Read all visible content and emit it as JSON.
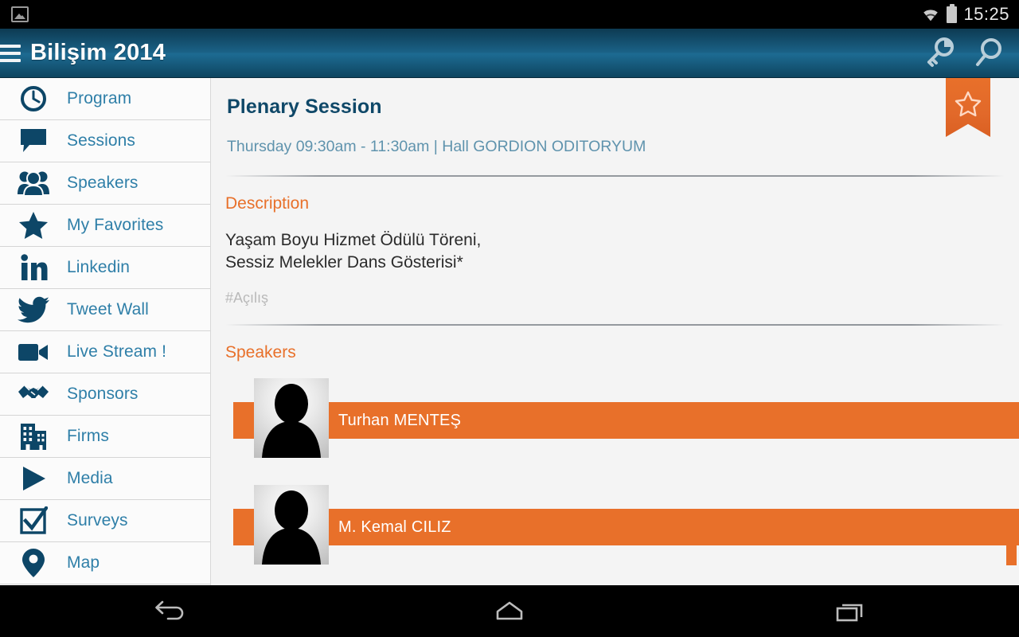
{
  "status_bar": {
    "notification_icon": "image-notification-icon",
    "wifi_icon": "wifi-icon",
    "battery_icon": "battery-icon",
    "clock": "15:25"
  },
  "action_bar": {
    "menu_icon": "hamburger-menu-icon",
    "title": "Bilişim 2014",
    "actions": [
      {
        "name": "key-icon",
        "label": "Key"
      },
      {
        "name": "search-icon",
        "label": "Search"
      }
    ],
    "gradient_top": "#0d3a52",
    "gradient_mid": "#1d6b92"
  },
  "sidebar": {
    "items": [
      {
        "label": "Program",
        "icon": "clock-icon"
      },
      {
        "label": "Sessions",
        "icon": "speech-bubble-icon"
      },
      {
        "label": "Speakers",
        "icon": "people-icon"
      },
      {
        "label": "My Favorites",
        "icon": "star-icon"
      },
      {
        "label": "Linkedin",
        "icon": "linkedin-icon"
      },
      {
        "label": "Tweet Wall",
        "icon": "twitter-bird-icon"
      },
      {
        "label": "Live Stream !",
        "icon": "video-camera-icon"
      },
      {
        "label": "Sponsors",
        "icon": "handshake-icon"
      },
      {
        "label": "Firms",
        "icon": "buildings-icon"
      },
      {
        "label": "Media",
        "icon": "play-icon"
      },
      {
        "label": "Surveys",
        "icon": "checkbox-checked-icon"
      },
      {
        "label": "Map",
        "icon": "map-pin-icon"
      }
    ],
    "label_color": "#2f7fa8",
    "icon_color": "#0d4667"
  },
  "session": {
    "title": "Plenary Session",
    "meta": "Thursday 09:30am - 11:30am | Hall GORDION ODITORYUM",
    "favorite_ribbon": {
      "name": "favorite-star-ribbon",
      "color": "#e8702a"
    },
    "description": {
      "heading": "Description",
      "line1": "Yaşam Boyu Hizmet Ödülü Töreni,",
      "line2": "Sessiz Melekler Dans Gösterisi*",
      "hashtag": "#Açılış"
    },
    "speakers_section": {
      "heading": "Speakers",
      "speakers": [
        {
          "name": "Turhan MENTEŞ",
          "photo": "speaker-avatar-placeholder"
        },
        {
          "name": "M. Kemal CILIZ",
          "photo": "speaker-avatar-placeholder"
        }
      ]
    },
    "accent_color": "#e8702a",
    "title_color": "#0f4868",
    "meta_color": "#5f93ad"
  },
  "nav_bar": {
    "buttons": [
      {
        "name": "back-button",
        "label": "Back"
      },
      {
        "name": "home-button",
        "label": "Home"
      },
      {
        "name": "recents-button",
        "label": "Recent apps"
      }
    ]
  }
}
